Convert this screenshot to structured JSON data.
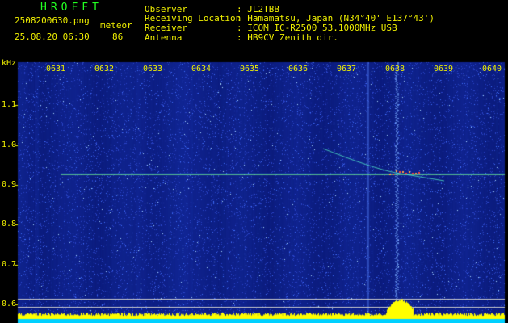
{
  "app": {
    "name": "HROFFT"
  },
  "file": {
    "name": "2508200630.png",
    "datetime": "25.08.20 06:30"
  },
  "meteor": {
    "label": "meteor",
    "count": "86"
  },
  "station": {
    "rows": [
      {
        "key": "Observer",
        "value": ": JL2TBB"
      },
      {
        "key": "Receiving Location",
        "value": ": Hamamatsu, Japan (N34°40' E137°43')"
      },
      {
        "key": "Receiver",
        "value": ": ICOM IC-R2500 53.1000MHz USB"
      },
      {
        "key": "Antenna",
        "value": ": HB9CV Zenith dir."
      }
    ]
  },
  "axis": {
    "unit": "kHz",
    "y_ticks": [
      "1.1",
      "1.0",
      "0.9",
      "0.8",
      "0.7",
      "0.6"
    ],
    "x_ticks": [
      "0631",
      "0632",
      "0633",
      "0634",
      "0635",
      "0636",
      "0637",
      "0638",
      "0639",
      "0640"
    ]
  },
  "colors": {
    "background": "#000000",
    "label": "#f0f000",
    "title": "#22ff22",
    "noise": "#1a2ea0",
    "signal": "#40e0ff",
    "spectrum": "#ffff00",
    "baseline": "#00d0ff"
  }
}
